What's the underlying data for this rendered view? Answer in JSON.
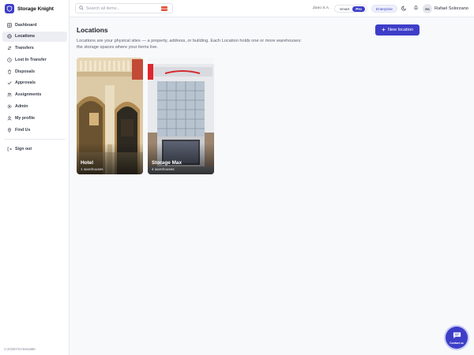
{
  "brand": {
    "name": "Storage Knight",
    "color": "#3d3ec8"
  },
  "sidebar": {
    "items": [
      {
        "label": "Dashboard",
        "icon": "grid-icon"
      },
      {
        "label": "Locations",
        "icon": "globe-icon",
        "active": true
      },
      {
        "label": "Transfers",
        "icon": "arrows-icon"
      },
      {
        "label": "Lost In Transfer",
        "icon": "clock-icon"
      },
      {
        "label": "Disposals",
        "icon": "trash-icon"
      },
      {
        "label": "Approvals",
        "icon": "check-icon"
      },
      {
        "label": "Assignments",
        "icon": "users-icon"
      },
      {
        "label": "Admin",
        "icon": "gear-icon"
      },
      {
        "label": "My profile",
        "icon": "user-icon"
      },
      {
        "label": "Find Us",
        "icon": "map-icon"
      }
    ],
    "signout_label": "Sign out",
    "version": "V-20250723-Beta888"
  },
  "header": {
    "search_placeholder": "Search all items...",
    "kbd": "Ctrl+K",
    "org": "Zano S.A.",
    "plans": [
      "Smart",
      "Pro"
    ],
    "active_plan": "Pro",
    "enterprise_label": "Enterprise",
    "avatar_initials": "RS",
    "user_name": "Rafael Solorzano"
  },
  "main": {
    "title": "Locations",
    "new_button_label": "New location",
    "description": "Locations are your physical sites — a property, address, or building. Each Location holds one or more warehouses: the storage spaces where your items live.",
    "cards": [
      {
        "name": "Hotel",
        "sub": "1 warehouses"
      },
      {
        "name": "Storage Max",
        "sub": "4 warehouses"
      }
    ]
  },
  "contact": {
    "label": "Contact us"
  }
}
